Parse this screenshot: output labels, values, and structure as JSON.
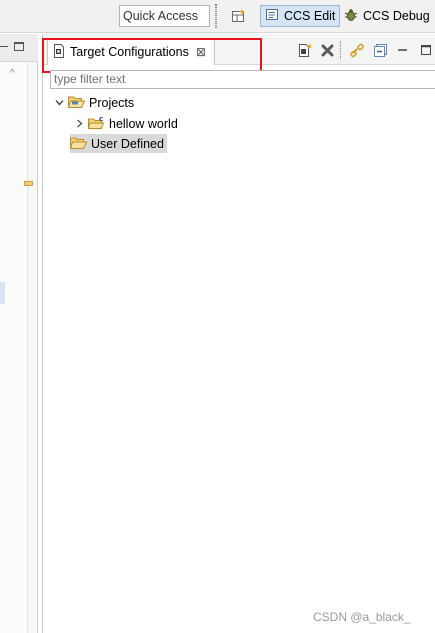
{
  "toolbar": {
    "quick_access_placeholder": "Quick Access",
    "open_perspective_icon": "open-perspective-icon",
    "perspectives": [
      {
        "label": "CCS Edit",
        "icon": "ccs-edit-icon",
        "active": true
      },
      {
        "label": "CCS Debug",
        "icon": "ccs-debug-icon",
        "active": false
      }
    ]
  },
  "view": {
    "tab_title": "Target Configurations",
    "tab_close_glyph": "⊠",
    "filter_placeholder": "type filter text",
    "actions": [
      "new-target-config-icon",
      "delete-icon",
      "link-with-editor-icon",
      "collapse-all-icon",
      "minimize-icon",
      "maximize-icon"
    ],
    "tree": {
      "projects_label": "Projects",
      "project_item_label": "hellow world",
      "user_defined_label": "User Defined"
    }
  },
  "watermark": "CSDN @a_black_",
  "colors": {
    "highlight_border": "#e8141b",
    "active_perspective": "#d5e5f5",
    "folder": "#e8c15a",
    "selection": "#d9d9d9"
  }
}
